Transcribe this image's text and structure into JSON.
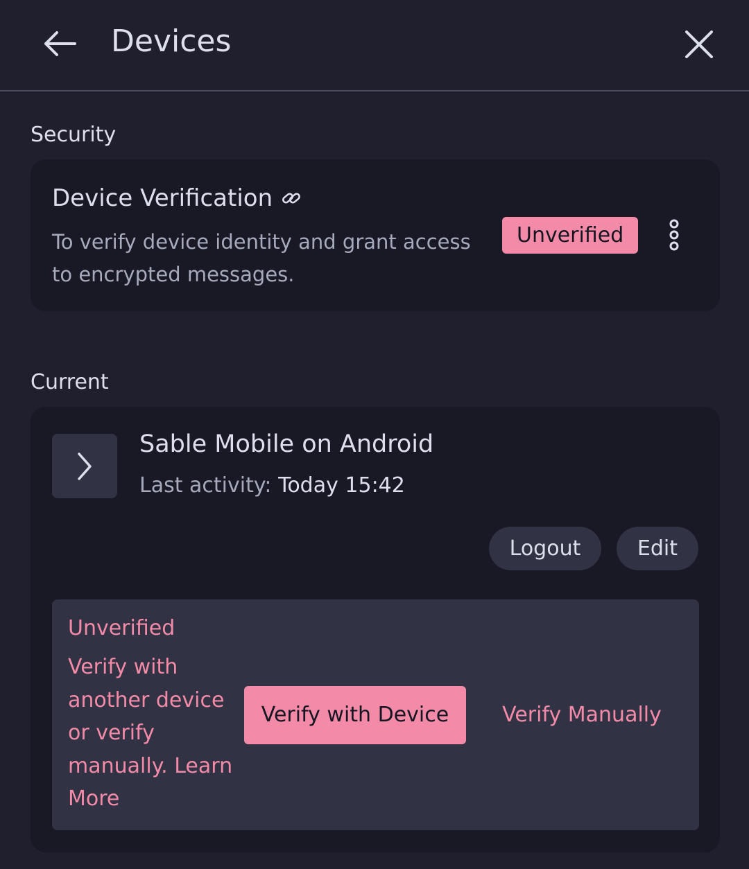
{
  "header": {
    "title": "Devices",
    "back_icon": "arrow-left-icon",
    "close_icon": "close-icon"
  },
  "security": {
    "section_label": "Security",
    "card": {
      "title": "Device Verification",
      "title_icon": "link-icon",
      "description": "To verify device identity and grant access to encrypted messages.",
      "badge": "Unverified",
      "menu_icon": "kebab-menu-icon"
    }
  },
  "current": {
    "section_label": "Current",
    "device": {
      "expand_icon": "chevron-right-icon",
      "name": "Sable Mobile on Android",
      "last_activity_label": "Last activity:",
      "last_activity_value": "Today 15:42"
    },
    "actions": {
      "logout_label": "Logout",
      "edit_label": "Edit"
    },
    "verification": {
      "title": "Unverified",
      "description": "Verify with another device or verify manually. Learn More",
      "verify_device_label": "Verify with Device",
      "verify_manual_label": "Verify Manually"
    }
  },
  "colors": {
    "background": "#1f1f2e",
    "card": "#191925",
    "surface": "#313244",
    "accent": "#f38ba8",
    "text": "#dde0ec",
    "muted_text": "#a7aabd"
  }
}
